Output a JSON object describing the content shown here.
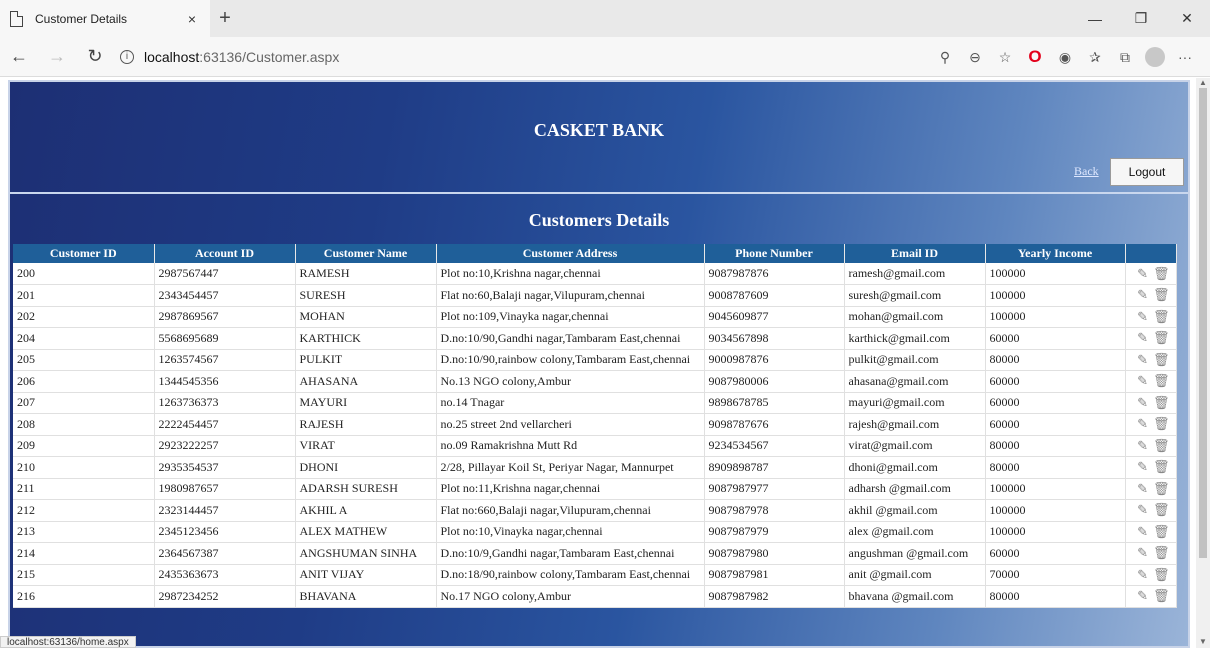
{
  "browser": {
    "tab_title": "Customer Details",
    "tab_close": "×",
    "new_tab": "+",
    "url_host": "localhost",
    "url_path": ":63136/Customer.aspx",
    "status_url": "localhost:63136/home.aspx"
  },
  "page": {
    "bank_title": "CASKET BANK",
    "back_label": "Back",
    "logout_label": "Logout",
    "section_title": "Customers Details"
  },
  "table": {
    "headers": [
      "Customer ID",
      "Account ID",
      "Customer Name",
      "Customer Address",
      "Phone Number",
      "Email ID",
      "Yearly Income",
      ""
    ],
    "rows": [
      [
        "200",
        "2987567447",
        "RAMESH",
        "Plot no:10,Krishna nagar,chennai",
        "9087987876",
        "ramesh@gmail.com",
        "100000"
      ],
      [
        "201",
        "2343454457",
        "SURESH",
        "Flat no:60,Balaji nagar,Vilupuram,chennai",
        "9008787609",
        "suresh@gmail.com",
        "100000"
      ],
      [
        "202",
        "2987869567",
        "MOHAN",
        "Plot no:109,Vinayka nagar,chennai",
        "9045609877",
        "mohan@gmail.com",
        "100000"
      ],
      [
        "204",
        "5568695689",
        "KARTHICK",
        "D.no:10/90,Gandhi nagar,Tambaram East,chennai",
        "9034567898",
        "karthick@gmail.com",
        "60000"
      ],
      [
        "205",
        "1263574567",
        "PULKIT",
        "D.no:10/90,rainbow colony,Tambaram East,chennai",
        "9000987876",
        "pulkit@gmail.com",
        "80000"
      ],
      [
        "206",
        "1344545356",
        "AHASANA",
        "No.13 NGO colony,Ambur",
        "9087980006",
        "ahasana@gmail.com",
        "60000"
      ],
      [
        "207",
        "1263736373",
        "MAYURI",
        "no.14 Tnagar",
        "9898678785",
        "mayuri@gmail.com",
        "60000"
      ],
      [
        "208",
        "2222454457",
        "RAJESH",
        "no.25 street 2nd vellarcheri",
        "9098787676",
        "rajesh@gmail.com",
        "60000"
      ],
      [
        "209",
        "2923222257",
        "VIRAT",
        "no.09 Ramakrishna Mutt Rd",
        "9234534567",
        "virat@gmail.com",
        "80000"
      ],
      [
        "210",
        "2935354537",
        "DHONI",
        "2/28, Pillayar Koil St, Periyar Nagar, Mannurpet",
        "8909898787",
        "dhoni@gmail.com",
        "80000"
      ],
      [
        "211",
        "1980987657",
        "ADARSH SURESH",
        "Plot no:11,Krishna nagar,chennai",
        "9087987977",
        "adharsh @gmail.com",
        "100000"
      ],
      [
        "212",
        "2323144457",
        "AKHIL A",
        "Flat no:660,Balaji nagar,Vilupuram,chennai",
        "9087987978",
        "akhil @gmail.com",
        "100000"
      ],
      [
        "213",
        "2345123456",
        "ALEX MATHEW",
        "Plot no:10,Vinayka nagar,chennai",
        "9087987979",
        "alex @gmail.com",
        "100000"
      ],
      [
        "214",
        "2364567387",
        "ANGSHUMAN SINHA",
        "D.no:10/9,Gandhi nagar,Tambaram East,chennai",
        "9087987980",
        "angushman @gmail.com",
        "60000"
      ],
      [
        "215",
        "2435363673",
        "ANIT VIJAY",
        "D.no:18/90,rainbow colony,Tambaram East,chennai",
        "9087987981",
        "anit @gmail.com",
        "70000"
      ],
      [
        "216",
        "2987234252",
        "BHAVANA",
        "No.17 NGO colony,Ambur",
        "9087987982",
        "bhavana @gmail.com",
        "80000"
      ]
    ]
  },
  "icons": {
    "edit": "pencil-icon",
    "delete": "trash-icon"
  }
}
